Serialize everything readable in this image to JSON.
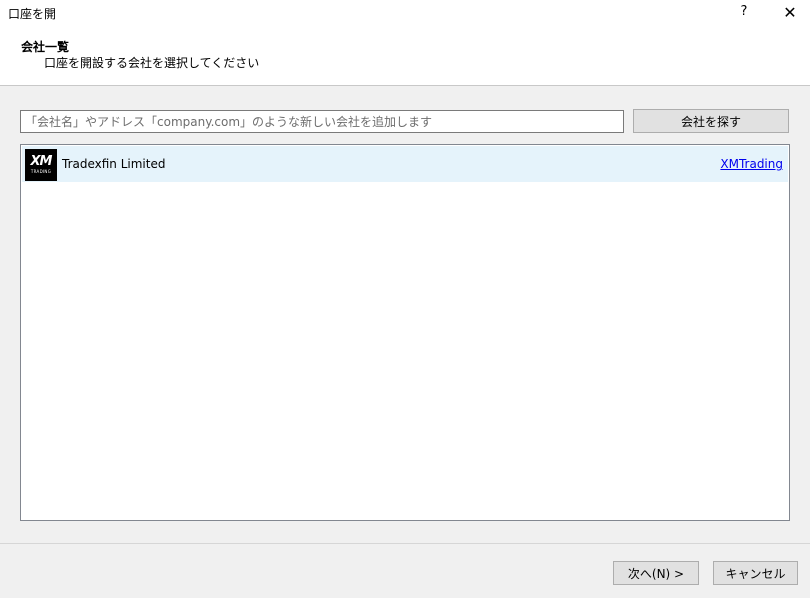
{
  "window": {
    "title": "口座を開",
    "help_glyph": "?",
    "close_glyph": "✕"
  },
  "header": {
    "heading": "会社一覧",
    "subtitle": "口座を開設する会社を選択してください"
  },
  "search": {
    "placeholder": "「会社名」やアドレス「company.com」のような新しい会社を追加します",
    "value": "",
    "button_label": "会社を探す"
  },
  "companies": [
    {
      "logo": {
        "mark": "XM",
        "sub": "TRADING"
      },
      "name": "Tradexfin Limited",
      "server": "XMTrading"
    }
  ],
  "footer": {
    "next_label": "次へ(N) >",
    "cancel_label": "キャンセル"
  },
  "colors": {
    "selected_row": "#e5f3fb",
    "link": "#0000ee",
    "button_face": "#e1e1e1"
  }
}
